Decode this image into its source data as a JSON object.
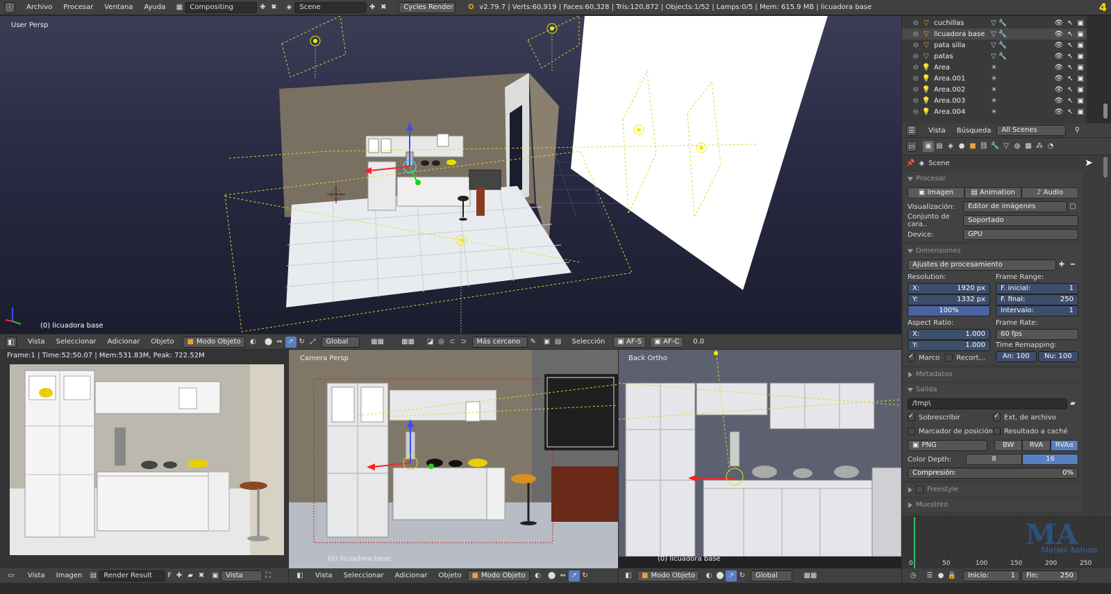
{
  "top_menu": {
    "items": [
      "Archivo",
      "Procesar",
      "Ventana",
      "Ayuda"
    ],
    "screen_layout": "Compositing",
    "scene": "Scene",
    "engine": "Cycles Render",
    "stats": "v2.79.7 | Verts:60,919 | Faces:60,328 | Tris:120,872 | Objects:1/52 | Lamps:0/5 | Mem: 615.9 MB | licuadora base",
    "corner_num": "4"
  },
  "viewport_main": {
    "label": "User Persp",
    "object_label": "(0) licuadora base"
  },
  "viewport_header": {
    "items": [
      "Vista",
      "Seleccionar",
      "Adicionar",
      "Objeto"
    ],
    "mode": "Modo Objeto",
    "orientation": "Global",
    "snap": "Más cercano",
    "seleccion": "Selección",
    "afs": "AF-S",
    "afc": "AF-C",
    "value": "0.0"
  },
  "render_view": {
    "info": "Frame:1 | Time:52:50.07 | Mem:531.83M, Peak: 722.52M",
    "menu": [
      "Vista",
      "Imagen"
    ],
    "image": "Render Result",
    "slot": "F",
    "view": "Vista"
  },
  "camera_view": {
    "label": "Camera Persp",
    "object_label": "(0) licuadora base",
    "menu": [
      "Vista",
      "Seleccionar",
      "Adicionar",
      "Objeto"
    ],
    "mode": "Modo Objeto"
  },
  "back_view": {
    "label": "Back Ortho",
    "object_label": "(0) licuadora base",
    "mode": "Modo Objeto",
    "orientation": "Global"
  },
  "outliner": {
    "items": [
      {
        "name": "cuchillas",
        "type": "mesh"
      },
      {
        "name": "licuadora base",
        "type": "mesh",
        "selected": true
      },
      {
        "name": "pata silla",
        "type": "mesh"
      },
      {
        "name": "patas",
        "type": "mesh"
      },
      {
        "name": "Área",
        "type": "lamp"
      },
      {
        "name": "Área.001",
        "type": "lamp"
      },
      {
        "name": "Área.002",
        "type": "lamp"
      },
      {
        "name": "Área.003",
        "type": "lamp"
      },
      {
        "name": "Área.004",
        "type": "lamp"
      }
    ],
    "menu": [
      "Vista",
      "Búsqueda"
    ],
    "filter": "All Scenes"
  },
  "props": {
    "scene_name": "Scene",
    "procesar": {
      "title": "Procesar",
      "tabs": [
        "Imagen",
        "Animation",
        "Audio"
      ],
      "visualizacion_label": "Visualización:",
      "visualizacion": "Editor de imágenes",
      "conjunto_label": "Conjunto de cara..",
      "conjunto": "Soportado",
      "device_label": "Device:",
      "device": "GPU"
    },
    "dimensiones": {
      "title": "Dimensiones",
      "preset": "Ajustes de procesamiento",
      "resolution_label": "Resolution:",
      "x_label": "X:",
      "x": "1920 px",
      "y_label": "Y:",
      "y": "1332 px",
      "pct": "100%",
      "frame_range_label": "Frame Range:",
      "f_ini_label": "F. inicial:",
      "f_ini": "1",
      "f_fin_label": "F. final:",
      "f_fin": "250",
      "intervalo_label": "Intervalo:",
      "intervalo": "1",
      "aspect_label": "Aspect Ratio:",
      "ax": "1.000",
      "ay": "1.000",
      "frame_rate_label": "Frame Rate:",
      "frame_rate": "60 fps",
      "marco": "Marco",
      "recort": "Recort...",
      "remap_label": "Time Remapping:",
      "an": "An: 100",
      "nu": "Nu: 100"
    },
    "metadatos": "Metadatos",
    "salida": {
      "title": "Salida",
      "path": "/tmp\\",
      "sobrescribir": "Sobrescribir",
      "ext": "Ext. de archivo",
      "marcador": "Marcador de posición",
      "resultado": "Resultado a caché",
      "format": "PNG",
      "bw": "BW",
      "rva": "RVA",
      "rvaa": "RVAα",
      "depth_label": "Color Depth:",
      "d8": "8",
      "d16": "16",
      "compresion_label": "Compresión:",
      "compresion": "0%"
    },
    "freestyle": "Freestyle",
    "muestreo": "Muestreo"
  },
  "timeline": {
    "ticks": [
      "0",
      "50",
      "100",
      "150",
      "200",
      "250"
    ],
    "inicio": "Inicio:",
    "inicio_val": "1",
    "fin": "Fin:",
    "fin_val": "250",
    "watermark": "Matias Antona"
  }
}
